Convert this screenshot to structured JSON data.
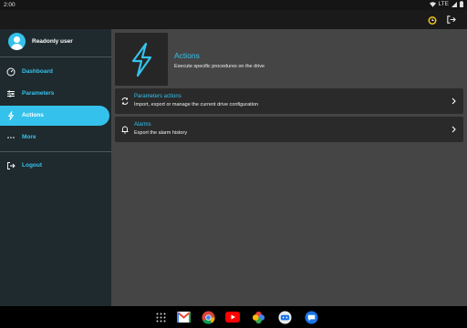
{
  "status_bar": {
    "time": "2:00",
    "network": "LTE"
  },
  "user": {
    "name": "Readonly user"
  },
  "sidebar": {
    "items": [
      {
        "label": "Dashboard"
      },
      {
        "label": "Parameters"
      },
      {
        "label": "Actions"
      },
      {
        "label": "More"
      },
      {
        "label": "Logout"
      }
    ]
  },
  "header": {
    "title": "Actions",
    "subtitle": "Execute specific procedures on the drive"
  },
  "cards": [
    {
      "title": "Parameters actions",
      "description": "Import, export or manage the current drive configuration"
    },
    {
      "title": "Alarms",
      "description": "Export the alarm history"
    }
  ],
  "colors": {
    "accent": "#34c2ec",
    "sidebar": "#1f2a2e",
    "content": "#454545",
    "card": "#2a2a2a"
  },
  "icons": {
    "appbar": [
      "alarm-clock-icon",
      "logout-icon"
    ],
    "sidebar": [
      "dashboard-icon",
      "parameters-sliders-icon",
      "lightning-icon",
      "more-dots-icon",
      "logout-icon"
    ],
    "cards": [
      "sync-arrows-icon",
      "alarm-bell-icon"
    ],
    "dock": [
      "apps-grid-icon",
      "gmail-icon",
      "chrome-icon",
      "youtube-icon",
      "photos-icon",
      "messages-icon",
      "chat-icon"
    ]
  }
}
